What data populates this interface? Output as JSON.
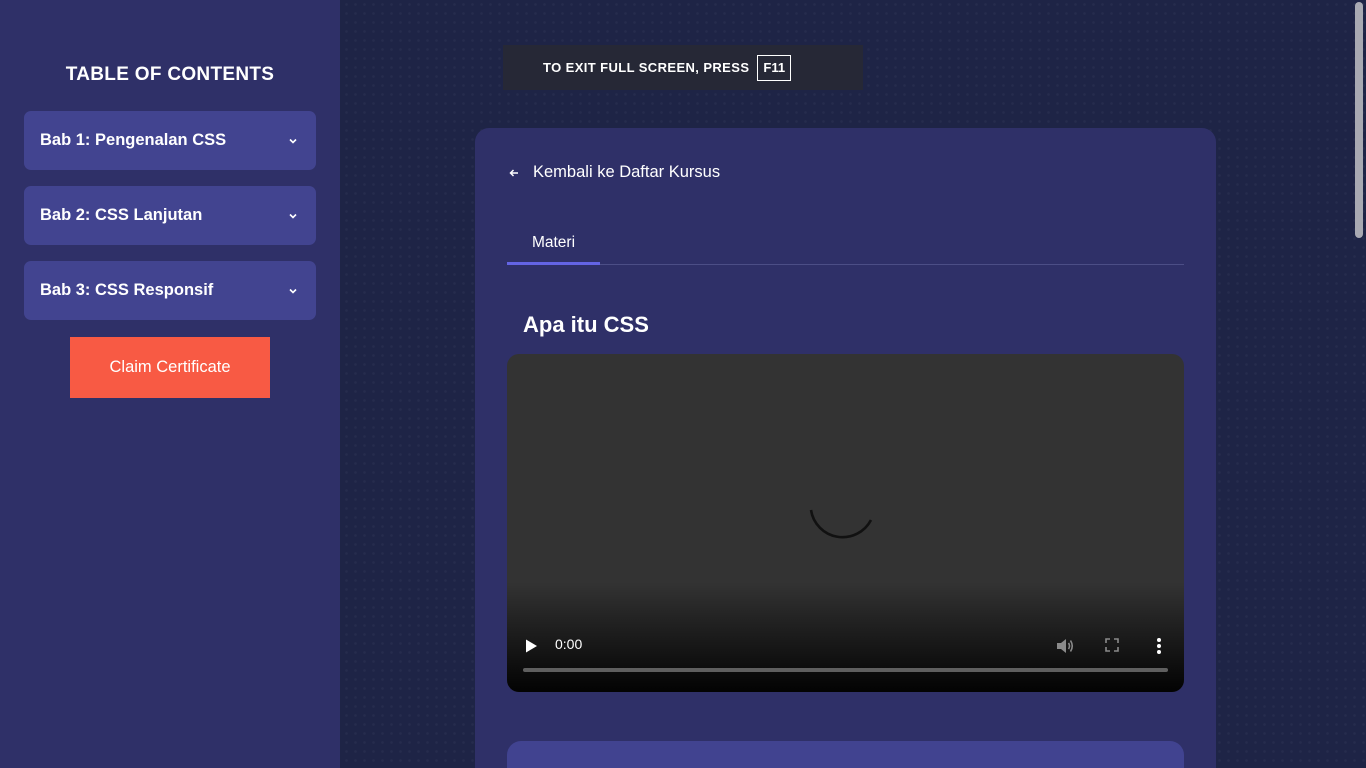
{
  "sidebar": {
    "title": "TABLE OF CONTENTS",
    "chapters": [
      {
        "label": "Bab 1: Pengenalan CSS",
        "icon": "chevron-down-icon"
      },
      {
        "label": "Bab 2: CSS Lanjutan",
        "icon": "chevron-down-icon"
      },
      {
        "label": "Bab 3: CSS Responsif",
        "icon": "chevron-down-icon"
      }
    ],
    "claim_button": "Claim Certificate"
  },
  "fullscreen_notice": {
    "text": "TO EXIT FULL SCREEN, PRESS",
    "key": "F11"
  },
  "main": {
    "back_link": "Kembali ke Daftar Kursus",
    "tabs": [
      {
        "label": "Materi",
        "active": true
      }
    ],
    "lesson_title": "Apa itu CSS",
    "video": {
      "time": "0:00",
      "state": "loading",
      "progress": 0
    }
  },
  "colors": {
    "page_bg": "#1e2446",
    "sidebar_bg": "#2f3068",
    "chapter_bg": "#424490",
    "accent_button": "#f85a44",
    "tab_underline": "#6464e4"
  }
}
